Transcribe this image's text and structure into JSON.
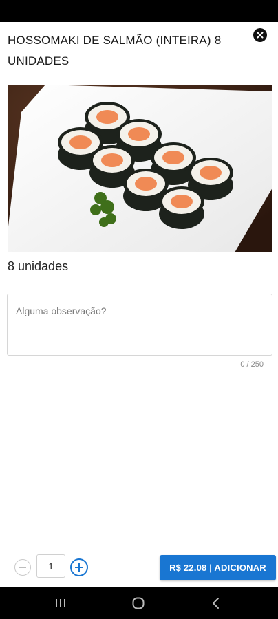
{
  "product": {
    "title": "HOSSOMAKI DE SALMÃO (INTEIRA) 8 UNIDADES",
    "image_icon": "sushi-photo",
    "subtitle": "8 unidades"
  },
  "observation": {
    "placeholder": "Alguma observação?",
    "value": "",
    "counter": "0 / 250"
  },
  "footer": {
    "quantity": "1",
    "add_label": "R$ 22.08 | ADICIONAR"
  },
  "colors": {
    "accent": "#1976d2",
    "status_bar": "#000000"
  },
  "icons": {
    "close": "close-icon",
    "minus": "minus-icon",
    "plus": "plus-icon",
    "recents": "recents-icon",
    "home": "home-icon",
    "back": "back-icon"
  }
}
